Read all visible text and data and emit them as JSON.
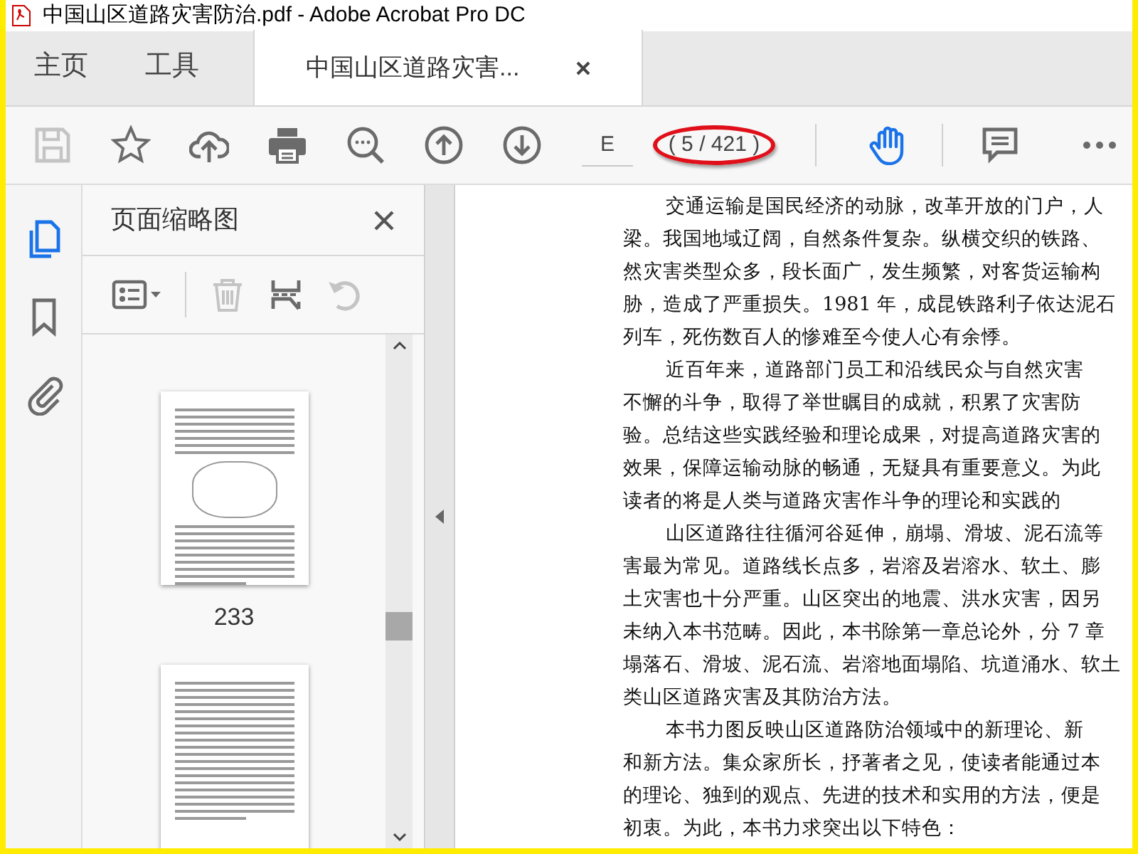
{
  "window": {
    "title": "中国山区道路灾害防治.pdf - Adobe Acrobat Pro DC"
  },
  "tabs": [
    {
      "label": "主页",
      "selected": false
    },
    {
      "label": "工具",
      "selected": false
    },
    {
      "label": "中国山区道路灾害...",
      "selected": true
    }
  ],
  "toolbar": {
    "buttons": [
      {
        "kind": "save",
        "disabled": true
      },
      {
        "kind": "bookmark",
        "disabled": false
      },
      {
        "kind": "upload",
        "disabled": false
      },
      {
        "kind": "print",
        "disabled": false
      },
      {
        "kind": "zoom",
        "disabled": false
      },
      {
        "kind": "previous",
        "disabled": false
      },
      {
        "kind": "next",
        "disabled": false
      }
    ],
    "page_field": {
      "value": "E"
    },
    "page_count": "( 5 / 421 )",
    "tools": [
      {
        "kind": "hand",
        "selected": true
      },
      {
        "kind": "comment",
        "selected": false
      },
      {
        "kind": "more",
        "selected": false
      }
    ]
  },
  "nav_rail": [
    {
      "kind": "pages",
      "selected": true
    },
    {
      "kind": "bookmarks",
      "selected": false
    },
    {
      "kind": "attachments",
      "selected": false
    }
  ],
  "thumbnail_panel": {
    "title": "页面缩略图",
    "tools": [
      {
        "kind": "options",
        "disabled": false
      },
      {
        "kind": "delete",
        "disabled": true
      },
      {
        "kind": "extract",
        "disabled": false
      },
      {
        "kind": "undo",
        "disabled": true
      }
    ],
    "thumbnails": [
      {
        "kind": "page",
        "label": "233"
      },
      {
        "kind": "page"
      }
    ]
  },
  "document": {
    "paragraphs": [
      {
        "lines": [
          "交通运输是国民经济的动脉，改革开放的门户，人",
          "梁。我国地域辽阔，自然条件复杂。纵横交织的铁路、",
          "然灾害类型众多，段长面广，发生频繁，对客货运输构",
          "胁，造成了严重损失。1981 年，成昆铁路利子依达泥石",
          "列车，死伤数百人的惨难至今使人心有余悸。"
        ]
      },
      {
        "lines": [
          "近百年来，道路部门员工和沿线民众与自然灾害",
          "不懈的斗争，取得了举世瞩目的成就，积累了灾害防",
          "验。总结这些实践经验和理论成果，对提高道路灾害的",
          "效果，保障运输动脉的畅通，无疑具有重要意义。为此",
          "读者的将是人类与道路灾害作斗争的理论和实践的"
        ]
      },
      {
        "lines": [
          "山区道路往往循河谷延伸，崩塌、滑坡、泥石流等",
          "害最为常见。道路线长点多，岩溶及岩溶水、软土、膨",
          "土灾害也十分严重。山区突出的地震、洪水灾害，因另",
          "未纳入本书范畴。因此，本书除第一章总论外，分 7 章",
          "塌落石、滑坡、泥石流、岩溶地面塌陷、坑道涌水、软土",
          "类山区道路灾害及其防治方法。"
        ]
      },
      {
        "lines": [
          "本书力图反映山区道路防治领域中的新理论、新",
          "和新方法。集众家所长，抒著者之见，使读者能通过本",
          "的理论、独到的观点、先进的技术和实用的方法，便是",
          "初衷。为此，本书力求突出以下特色："
        ]
      }
    ]
  }
}
